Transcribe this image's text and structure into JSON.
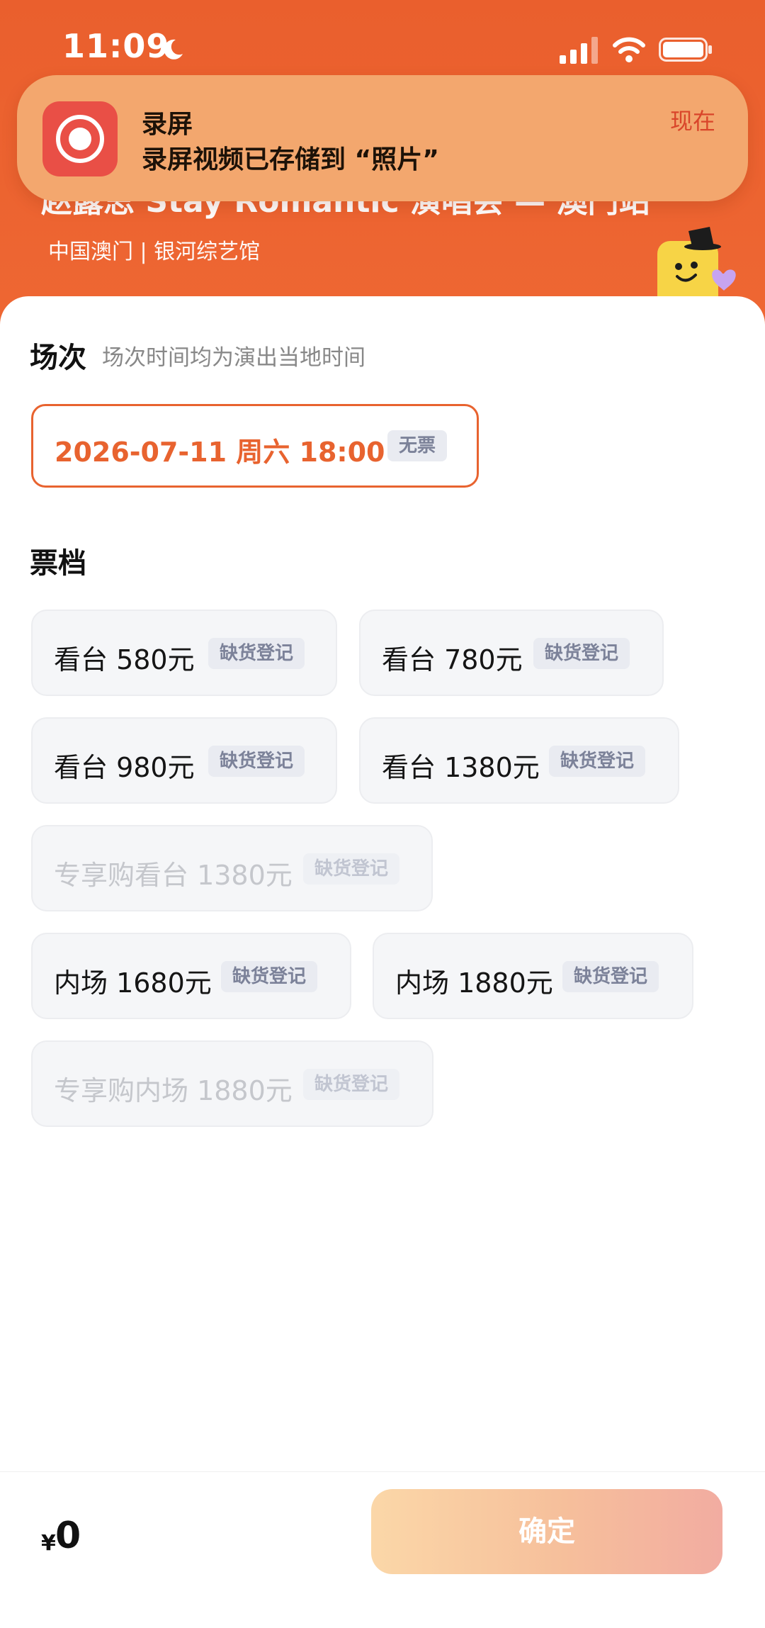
{
  "status_bar": {
    "time": "11:09"
  },
  "notification": {
    "app_name": "录屏",
    "message": "录屏视频已存储到 “照片”",
    "time": "现在"
  },
  "header": {
    "event_title": "赵露思 Stay Romantic 演唱会 — 澳门站",
    "venue": "中国澳门 | 银河综艺馆"
  },
  "session": {
    "title": "场次",
    "subtitle": "场次时间均为演出当地时间",
    "option": {
      "label": "2026-07-11 周六 18:00",
      "badge": "无票"
    }
  },
  "tiers": {
    "title": "票档",
    "items": [
      {
        "label": "看台 580元",
        "badge": "缺货登记",
        "disabled": false
      },
      {
        "label": "看台 780元",
        "badge": "缺货登记",
        "disabled": false
      },
      {
        "label": "看台 980元",
        "badge": "缺货登记",
        "disabled": false
      },
      {
        "label": "看台 1380元",
        "badge": "缺货登记",
        "disabled": false
      },
      {
        "label": "专享购看台 1380元",
        "badge": "缺货登记",
        "disabled": true
      },
      {
        "label": "内场 1680元",
        "badge": "缺货登记",
        "disabled": false
      },
      {
        "label": "内场 1880元",
        "badge": "缺货登记",
        "disabled": false
      },
      {
        "label": "专享购内场 1880元",
        "badge": "缺货登记",
        "disabled": true
      }
    ]
  },
  "bottom_bar": {
    "currency": "¥",
    "total": "0",
    "confirm_label": "确定"
  },
  "colors": {
    "accent": "#e8632f",
    "header": "#ec6330",
    "notification_bg": "#f3a76e"
  }
}
